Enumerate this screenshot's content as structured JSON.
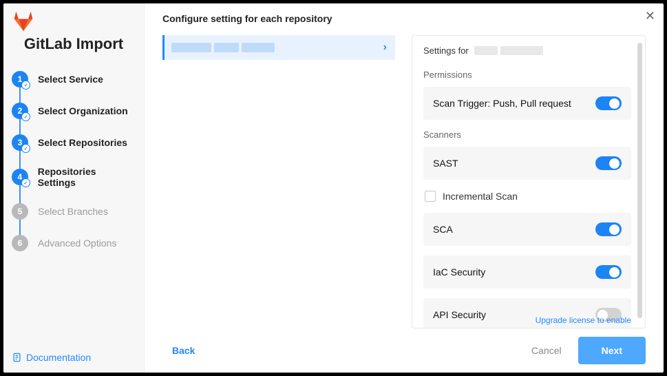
{
  "sidebar": {
    "title": "GitLab Import",
    "doc_link": "Documentation",
    "steps": [
      {
        "num": "1",
        "label": "Select Service",
        "done": true,
        "active": true
      },
      {
        "num": "2",
        "label": "Select Organization",
        "done": true,
        "active": true
      },
      {
        "num": "3",
        "label": "Select Repositories",
        "done": true,
        "active": true
      },
      {
        "num": "4",
        "label": "Repositories Settings",
        "done": true,
        "active": true
      },
      {
        "num": "5",
        "label": "Select Branches",
        "done": false,
        "active": false
      },
      {
        "num": "6",
        "label": "Advanced Options",
        "done": false,
        "active": false
      }
    ]
  },
  "main": {
    "heading": "Configure setting for each repository",
    "settings_for_label": "Settings for",
    "permissions_label": "Permissions",
    "scanners_label": "Scanners",
    "scan_trigger_label": "Scan Trigger: Push, Pull request",
    "rows": {
      "sast": "SAST",
      "sca": "SCA",
      "iac": "IaC Security",
      "api": "API Security"
    },
    "incremental_label": "Incremental Scan",
    "upgrade_hint": "Upgrade license to enable"
  },
  "footer": {
    "back": "Back",
    "cancel": "Cancel",
    "next": "Next"
  }
}
